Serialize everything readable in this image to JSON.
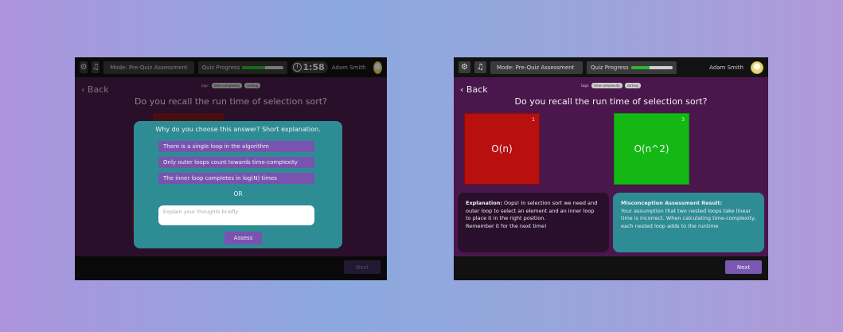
{
  "common": {
    "mode_label": "Mode: Pre-Quiz Assessment",
    "progress_label": "Quiz Progress",
    "user_name": "Adam Smith",
    "back_label": "Back",
    "tags_label": "tags:",
    "tags": [
      "time-complexity",
      "sorting"
    ],
    "question": "Do you recall the run time of selection sort?",
    "next_label": "Next",
    "icons": {
      "settings": "gear-icon",
      "music": "music-icon",
      "timer": "timer-icon",
      "avatar": "avatar-icon",
      "back": "chevron-left-icon"
    }
  },
  "left_screen": {
    "timer": "1:58",
    "progress_fraction": 0.55,
    "modal": {
      "title": "Why do you choose this answer? Short explanation.",
      "reasons": [
        "There is a single loop in the algorithm",
        "Only outer loops count towards time-complexity",
        "The inner loop completes in log(N) times"
      ],
      "or_label": "OR",
      "input_placeholder": "Explain your thoughts briefly",
      "assess_label": "Assess"
    }
  },
  "right_screen": {
    "progress_fraction": 0.45,
    "cards": [
      {
        "number": "1",
        "label": "O(n)",
        "color": "#b80f0f"
      },
      {
        "number": "3",
        "label": "O(n^2)",
        "color": "#14b814"
      }
    ],
    "explanation_heading": "Explanation:",
    "explanation_text": "Oops! In selection sort we need and outer loop to select an element and an inner loop to place it in the right position.",
    "explanation_footer": "Remember it for the next time!",
    "misconception_heading": "Misconception Assessment Result:",
    "misconception_text": "Your assumption that two nested loops take linear time is incorrect. When calculating time-complexity, each nested loop adds to the runtime"
  },
  "colors": {
    "screen_bg": "#471a49",
    "topbar_bg": "#121212",
    "teal": "#2e8c95",
    "purple_button": "#7a53b1",
    "wrong_red": "#b80f0f",
    "correct_green": "#14b814"
  }
}
